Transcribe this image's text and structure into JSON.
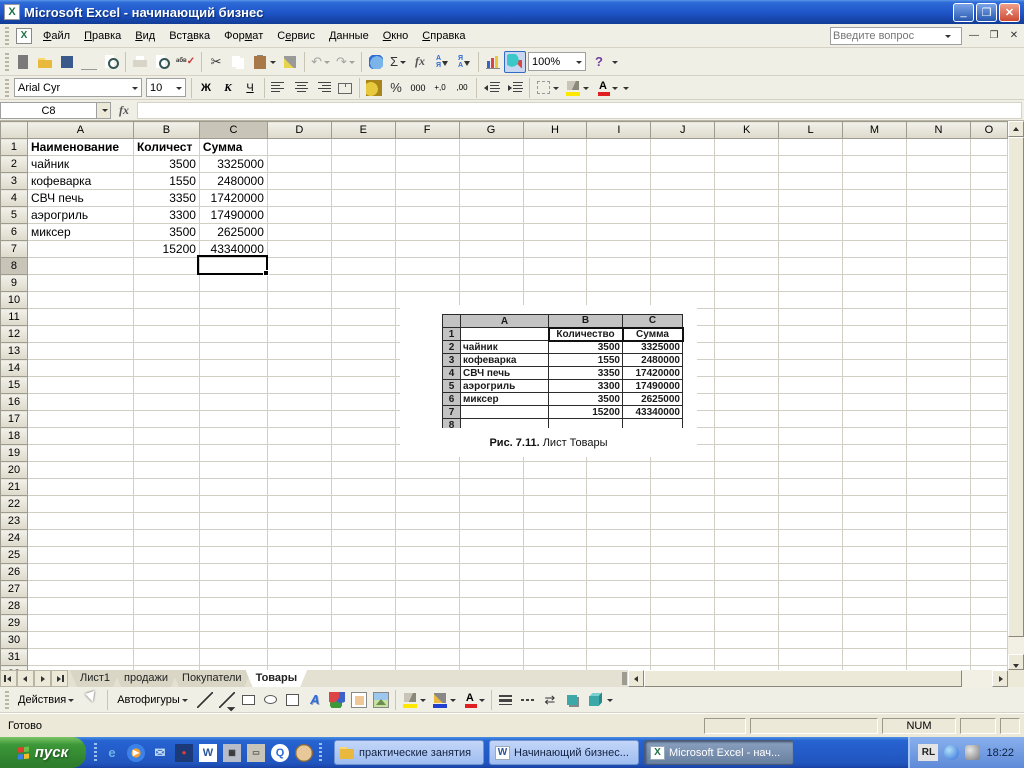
{
  "window": {
    "title": "Microsoft Excel - начинающий бизнес"
  },
  "menu": {
    "items": [
      {
        "label": "Файл",
        "u": 0
      },
      {
        "label": "Правка",
        "u": 0
      },
      {
        "label": "Вид",
        "u": 0
      },
      {
        "label": "Вставка",
        "u": 3
      },
      {
        "label": "Формат",
        "u": 3
      },
      {
        "label": "Сервис",
        "u": 1
      },
      {
        "label": "Данные",
        "u": 0
      },
      {
        "label": "Окно",
        "u": 0
      },
      {
        "label": "Справка",
        "u": 0
      }
    ],
    "question_placeholder": "Введите вопрос"
  },
  "standard_toolbar": {
    "zoom_value": "100%",
    "sum": "Σ",
    "fx": "fx",
    "spell": "абв",
    "sort_asc": "А\nЯ",
    "sort_desc": "Я\nА",
    "undo": "↶",
    "redo": "↷",
    "cut": "✂",
    "help": "?"
  },
  "formatting_toolbar": {
    "font": "Arial Cyr",
    "size": "10",
    "bold": "Ж",
    "italic": "К",
    "underline": "Ч",
    "percent": "%",
    "thousands": "000",
    "inc_decimal": "+,0",
    "dec_decimal": ",00",
    "font_letter": "А"
  },
  "formula_bar": {
    "name_box": "C8",
    "fx_label": "fx",
    "formula": ""
  },
  "grid": {
    "columns": [
      "A",
      "B",
      "C",
      "D",
      "E",
      "F",
      "G",
      "H",
      "I",
      "J",
      "K",
      "L",
      "M",
      "N",
      "O"
    ],
    "selected_column": "C",
    "selected_row": "8",
    "row_count": 32
  },
  "sheet": {
    "header_row": {
      "a": "Наименование",
      "b": "Количест",
      "c": "Сумма"
    },
    "rows": [
      {
        "a": "чайник",
        "b": "3500",
        "c": "3325000"
      },
      {
        "a": "кофеварка",
        "b": "1550",
        "c": "2480000"
      },
      {
        "a": "СВЧ печь",
        "b": "3350",
        "c": "17420000"
      },
      {
        "a": "аэрогриль",
        "b": "3300",
        "c": "17490000"
      },
      {
        "a": "миксер",
        "b": "3500",
        "c": "2625000"
      },
      {
        "a": "",
        "b": "15200",
        "c": "43340000"
      }
    ]
  },
  "figure": {
    "columns": [
      "A",
      "B",
      "C"
    ],
    "rows": [
      {
        "num": "1",
        "a": "",
        "b": "Количество",
        "c": "Сумма",
        "header": true
      },
      {
        "num": "2",
        "a": "чайник",
        "b": "3500",
        "c": "3325000"
      },
      {
        "num": "3",
        "a": "кофеварка",
        "b": "1550",
        "c": "2480000"
      },
      {
        "num": "4",
        "a": "СВЧ печь",
        "b": "3350",
        "c": "17420000"
      },
      {
        "num": "5",
        "a": "аэрогриль",
        "b": "3300",
        "c": "17490000"
      },
      {
        "num": "6",
        "a": "миксер",
        "b": "3500",
        "c": "2625000"
      },
      {
        "num": "7",
        "a": "",
        "b": "15200",
        "c": "43340000"
      }
    ],
    "partial_row": "8",
    "caption_bold": "Рис. 7.11.",
    "caption": " Лист Товары"
  },
  "tabs": {
    "items": [
      "Лист1",
      "продажи",
      "Покупатели",
      "Товары"
    ],
    "active_index": 3
  },
  "drawing_toolbar": {
    "actions_label": "Действия",
    "autoshapes_label": "Автофигуры"
  },
  "status_bar": {
    "mode": "Готово",
    "num_lock": "NUM"
  },
  "taskbar": {
    "start_label": "пуск",
    "tasks": [
      {
        "label": "практические занятия",
        "icon": "folder",
        "active": false
      },
      {
        "label": "Начинающий бизнес...",
        "icon": "word",
        "active": false
      },
      {
        "label": "Microsoft Excel - нач...",
        "icon": "excel",
        "active": true
      }
    ],
    "tray_lang": "RL",
    "clock": "18:22"
  },
  "colors": {
    "title_blue": "#1E54C8",
    "close_red": "#CE4A33",
    "excel_green": "#1E7145",
    "start_green": "#3C9838",
    "fill_yellow": "#FFE800",
    "font_red": "#E02020",
    "line_blue": "#2040D0",
    "header_select": "#C8C4B8"
  }
}
